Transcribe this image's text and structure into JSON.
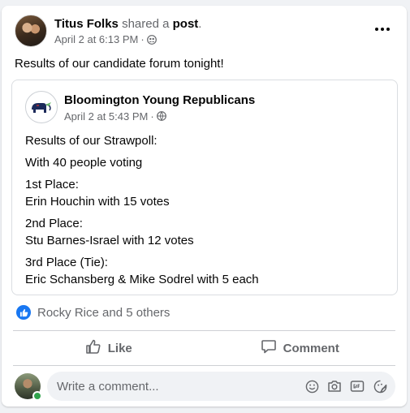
{
  "post": {
    "author": "Titus Folks",
    "action": "shared a",
    "object": "post",
    "object_end": ".",
    "date": "April 2 at 6:13 PM",
    "separator": "·",
    "audience_icon": "friends-icon",
    "text": "Results of our candidate forum tonight!"
  },
  "shared": {
    "page_name": "Bloomington Young Republicans",
    "date": "April 2 at 5:43 PM",
    "separator": "·",
    "audience_icon": "globe-icon",
    "lines": [
      "Results of our Strawpoll:",
      "With 40 people voting",
      "1st Place:",
      "Erin Houchin with 15 votes",
      "2nd Place:",
      "Stu Barnes-Israel with 12 votes",
      "3rd Place (Tie):",
      "Eric Schansberg & Mike Sodrel with 5 each"
    ]
  },
  "reactions": {
    "text": "Rocky Rice and 5 others",
    "icon": "like-reaction-icon"
  },
  "actions": {
    "like": "Like",
    "comment": "Comment"
  },
  "comment_box": {
    "placeholder": "Write a comment..."
  },
  "colors": {
    "brand_blue": "#1877f2",
    "secondary_text": "#65676b",
    "online_green": "#31a24c"
  }
}
